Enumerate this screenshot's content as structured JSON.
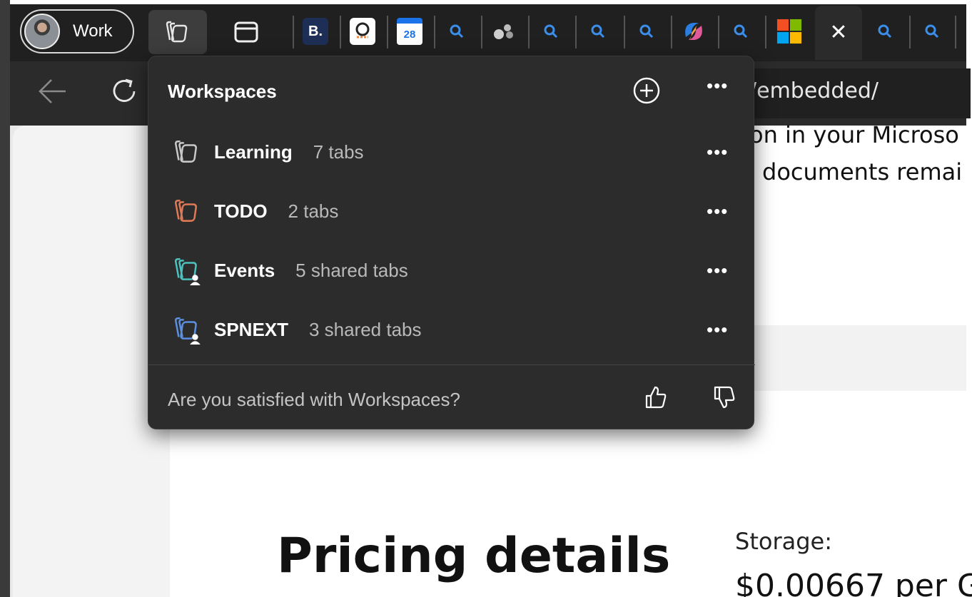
{
  "profile": {
    "label": "Work"
  },
  "browser": {
    "url_fragment": "/embedded/",
    "tabs": [
      {
        "icon": "b-app-icon",
        "label": "B."
      },
      {
        "icon": "q-app-icon",
        "label": ""
      },
      {
        "icon": "calendar-icon",
        "label": "28"
      },
      {
        "icon": "search-icon"
      },
      {
        "icon": "dots-app-icon"
      },
      {
        "icon": "search-icon"
      },
      {
        "icon": "search-icon"
      },
      {
        "icon": "search-icon"
      },
      {
        "icon": "copilot-icon"
      },
      {
        "icon": "search-icon"
      },
      {
        "icon": "microsoft-icon"
      },
      {
        "icon": "close-icon",
        "active": true
      },
      {
        "icon": "search-icon"
      },
      {
        "icon": "search-icon"
      }
    ]
  },
  "flyout": {
    "title": "Workspaces",
    "workspaces": [
      {
        "name": "Learning",
        "count": "7 tabs",
        "color": "#c8c8c8",
        "shared": false
      },
      {
        "name": "TODO",
        "count": "2 tabs",
        "color": "#e07a56",
        "shared": false
      },
      {
        "name": "Events",
        "count": "5 shared tabs",
        "color": "#4cc2c0",
        "shared": true
      },
      {
        "name": "SPNEXT",
        "count": "3 shared tabs",
        "color": "#5b8fe0",
        "shared": true
      }
    ],
    "feedback_question": "Are you satisfied with Workspaces?"
  },
  "page": {
    "line1": "on in your Microso",
    "line2": "documents remai",
    "heading": "Pricing details",
    "storage_label": "Storage:",
    "storage_price": "$0.00667 per G"
  },
  "colors": {
    "tabstrip": "#202020",
    "flyout_bg": "#2c2c2c",
    "accent_blue": "#3b8eea"
  }
}
